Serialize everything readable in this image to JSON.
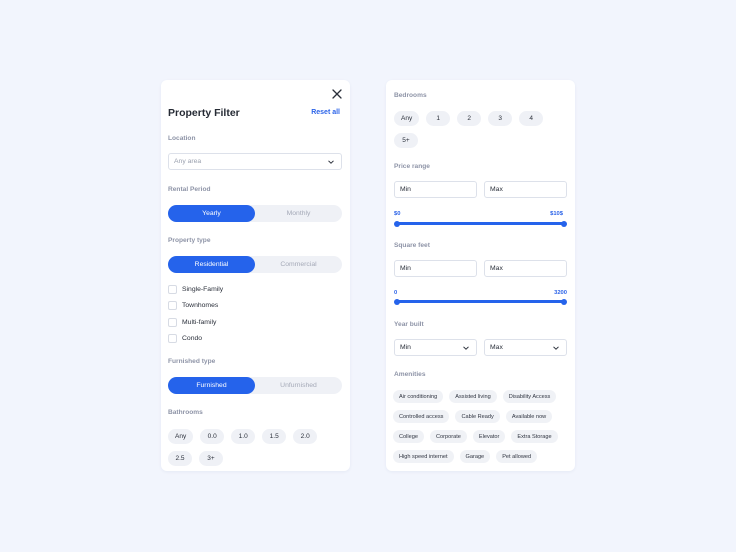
{
  "filter": {
    "title": "Property Filter",
    "reset_label": "Reset all",
    "location": {
      "label": "Location",
      "placeholder": "Any area"
    },
    "rental_period": {
      "label": "Rental Period",
      "options": [
        "Yearly",
        "Monthly"
      ],
      "selected": "Yearly"
    },
    "property_type": {
      "label": "Property type",
      "options": [
        "Residential",
        "Commercial"
      ],
      "selected": "Residential",
      "subtypes": [
        {
          "label": "Single-Family",
          "checked": false
        },
        {
          "label": "Townhomes",
          "checked": false
        },
        {
          "label": "Multi-family",
          "checked": false
        },
        {
          "label": "Condo",
          "checked": false
        }
      ]
    },
    "furnished_type": {
      "label": "Furnished type",
      "options": [
        "Furnished",
        "Unfurnished"
      ],
      "selected": "Furnished"
    },
    "bathrooms": {
      "label": "Bathrooms",
      "options": [
        "Any",
        "0.0",
        "1.0",
        "1.5",
        "2.0",
        "2.5",
        "3+"
      ]
    },
    "bedrooms": {
      "label": "Bedrooms",
      "options": [
        "Any",
        "1",
        "2",
        "3",
        "4",
        "5+"
      ]
    },
    "price_range": {
      "label": "Price range",
      "min_placeholder": "Min",
      "max_placeholder": "Max",
      "slider_min_label": "$0",
      "slider_max_label": "$10$",
      "slider_low_value": 0,
      "slider_high_fraction": 1.0
    },
    "square_feet": {
      "label": "Square feet",
      "min_placeholder": "Min",
      "max_placeholder": "Max",
      "slider_min_label": "0",
      "slider_max_label": "3200",
      "slider_low_value": 0,
      "slider_high_value": 3200
    },
    "year_built": {
      "label": "Year built",
      "min_value": "Min",
      "max_value": "Max"
    },
    "amenities": {
      "label": "Amenities",
      "items": [
        "Air conditioning",
        "Assisted living",
        "Disability Access",
        "Controlled access",
        "Cable Ready",
        "Available now",
        "College",
        "Corporate",
        "Elevator",
        "Extra Storage",
        "High speed internet",
        "Garage",
        "Pet allowed"
      ]
    }
  },
  "colors": {
    "accent": "#2563eb",
    "background": "#f2f5fd",
    "card": "#ffffff",
    "chip": "#eff1f6"
  }
}
